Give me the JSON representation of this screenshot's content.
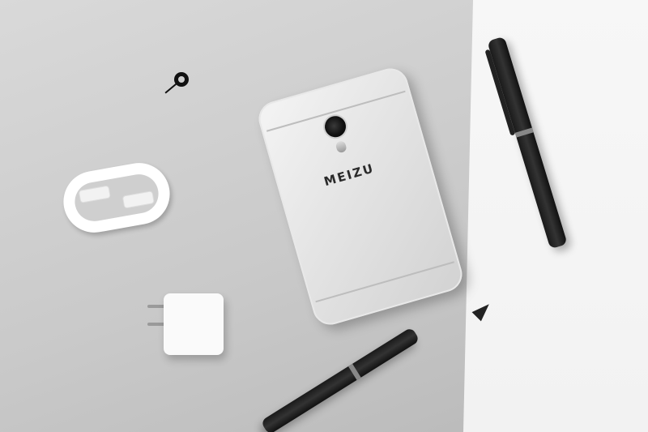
{
  "scene": {
    "phone": {
      "brand_text": "MEIZU"
    },
    "colors": {
      "backdrop_left": "#cccccc",
      "backdrop_right": "#f4f4f4",
      "ink_black": "#111111",
      "metal_silver": "#e0e0e0"
    }
  }
}
